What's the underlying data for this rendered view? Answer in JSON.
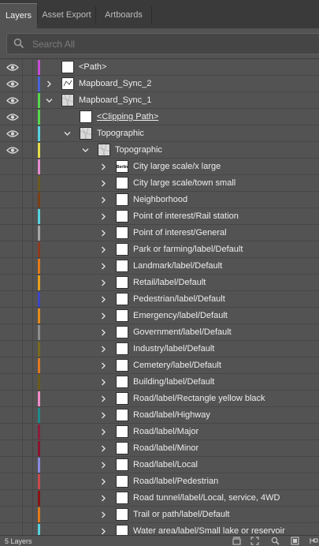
{
  "tabs": [
    "Layers",
    "Asset Export",
    "Artboards"
  ],
  "search": {
    "placeholder": "Search All"
  },
  "layers": [
    {
      "name": "<Path>",
      "color": "#c84bd6",
      "visible": true,
      "expand": "none",
      "thumb": "white"
    },
    {
      "name": "Mapboard_Sync_2",
      "color": "#4a63d9",
      "visible": true,
      "expand": "collapsed",
      "thumb": "path"
    },
    {
      "name": "Mapboard_Sync_1",
      "color": "#57d64e",
      "visible": true,
      "expand": "expanded",
      "thumb": "map"
    },
    {
      "name": "<Clipping Path>",
      "color": "#57d64e",
      "visible": true,
      "expand": "none",
      "thumb": "white",
      "clip": true
    },
    {
      "name": "Topographic",
      "color": "#57d1e0",
      "visible": true,
      "expand": "expanded",
      "thumb": "map"
    },
    {
      "name": "Topographic",
      "color": "#e6dd4a",
      "visible": true,
      "expand": "expanded",
      "thumb": "map"
    },
    {
      "name": "City large scale/x large",
      "color": "#e58bd0",
      "visible": false,
      "expand": "collapsed",
      "thumb": "text",
      "thumb_text": "Berlin"
    },
    {
      "name": "City large scale/town small",
      "color": "#6a5a1e",
      "visible": false,
      "expand": "collapsed",
      "thumb": "white"
    },
    {
      "name": "Neighborhood",
      "color": "#7b3f14",
      "visible": false,
      "expand": "collapsed",
      "thumb": "white"
    },
    {
      "name": "Point of interest/Rail station",
      "color": "#57d1e0",
      "visible": false,
      "expand": "collapsed",
      "thumb": "white"
    },
    {
      "name": "Point of interest/General",
      "color": "#a6a6a6",
      "visible": false,
      "expand": "collapsed",
      "thumb": "white"
    },
    {
      "name": "Park or farming/label/Default",
      "color": "#8f3a1f",
      "visible": false,
      "expand": "collapsed",
      "thumb": "white"
    },
    {
      "name": "Landmark/label/Default",
      "color": "#e07a1a",
      "visible": false,
      "expand": "collapsed",
      "thumb": "white"
    },
    {
      "name": "Retail/label/Default",
      "color": "#e6a01e",
      "visible": false,
      "expand": "collapsed",
      "thumb": "white"
    },
    {
      "name": "Pedestrian/label/Default",
      "color": "#3d45c8",
      "visible": false,
      "expand": "collapsed",
      "thumb": "white"
    },
    {
      "name": "Emergency/label/Default",
      "color": "#e68a1a",
      "visible": false,
      "expand": "collapsed",
      "thumb": "white"
    },
    {
      "name": "Government/label/Default",
      "color": "#8c8c8c",
      "visible": false,
      "expand": "collapsed",
      "thumb": "white"
    },
    {
      "name": "Industry/label/Default",
      "color": "#7a6a20",
      "visible": false,
      "expand": "collapsed",
      "thumb": "white"
    },
    {
      "name": "Cemetery/label/Default",
      "color": "#e07820",
      "visible": false,
      "expand": "collapsed",
      "thumb": "white"
    },
    {
      "name": "Building/label/Default",
      "color": "#6b5c1a",
      "visible": false,
      "expand": "collapsed",
      "thumb": "white"
    },
    {
      "name": "Road/label/Rectangle yellow black",
      "color": "#f08ac8",
      "visible": false,
      "expand": "collapsed",
      "thumb": "white"
    },
    {
      "name": "Road/label/Highway",
      "color": "#1e8a8a",
      "visible": false,
      "expand": "collapsed",
      "thumb": "white"
    },
    {
      "name": "Road/label/Major",
      "color": "#8a1e3a",
      "visible": false,
      "expand": "collapsed",
      "thumb": "white"
    },
    {
      "name": "Road/label/Minor",
      "color": "#8a1430",
      "visible": false,
      "expand": "collapsed",
      "thumb": "white"
    },
    {
      "name": "Road/label/Local",
      "color": "#8a8ae0",
      "visible": false,
      "expand": "collapsed",
      "thumb": "white"
    },
    {
      "name": "Road/label/Pedestrian",
      "color": "#c84a4a",
      "visible": false,
      "expand": "collapsed",
      "thumb": "white"
    },
    {
      "name": "Road tunnel/label/Local, service, 4WD",
      "color": "#8a1414",
      "visible": false,
      "expand": "collapsed",
      "thumb": "white"
    },
    {
      "name": "Trail or path/label/Default",
      "color": "#e07a1a",
      "visible": false,
      "expand": "collapsed",
      "thumb": "white"
    },
    {
      "name": "Water area/label/Small lake or reservoir",
      "color": "#57d1e0",
      "visible": false,
      "expand": "collapsed",
      "thumb": "white"
    }
  ],
  "footer": {
    "count": "5 Layers"
  },
  "footer_icons": [
    "export-for-screens-icon",
    "collect-for-export-icon",
    "locate-object-icon",
    "make-clipping-mask-icon",
    "create-sublayer-icon"
  ]
}
